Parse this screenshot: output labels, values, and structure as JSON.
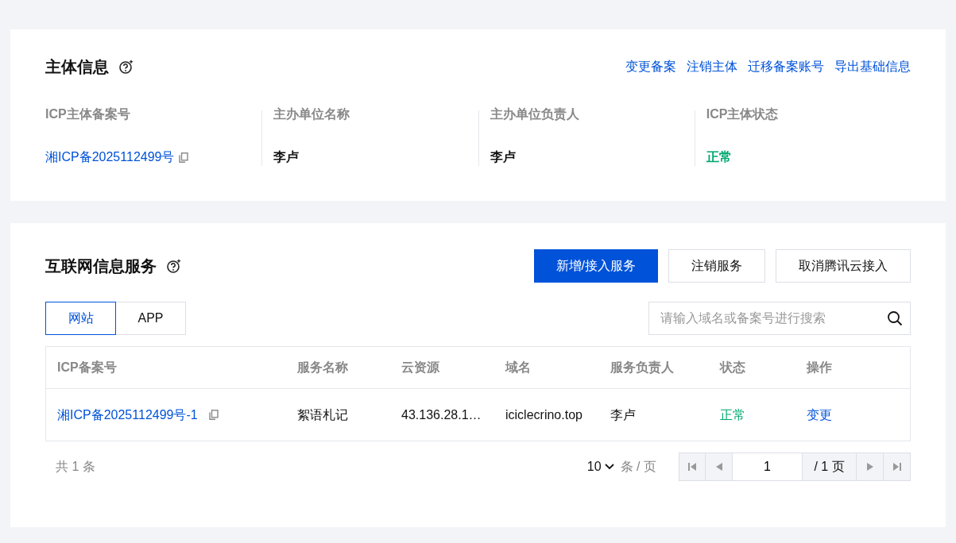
{
  "subject": {
    "title": "主体信息",
    "actions": [
      "变更备案",
      "注销主体",
      "迁移备案账号",
      "导出基础信息"
    ],
    "fields": [
      {
        "label": "ICP主体备案号",
        "value": "湘ICP备2025112499号",
        "kind": "link"
      },
      {
        "label": "主办单位名称",
        "value": "李卢",
        "kind": "text"
      },
      {
        "label": "主办单位负责人",
        "value": "李卢",
        "kind": "text"
      },
      {
        "label": "ICP主体状态",
        "value": "正常",
        "kind": "status"
      }
    ]
  },
  "services": {
    "title": "互联网信息服务",
    "buttons": [
      {
        "label": "新增/接入服务",
        "primary": true
      },
      {
        "label": "注销服务",
        "primary": false
      },
      {
        "label": "取消腾讯云接入",
        "primary": false
      }
    ],
    "tabs": [
      {
        "label": "网站",
        "selected": true
      },
      {
        "label": "APP",
        "selected": false
      }
    ],
    "search": {
      "placeholder": "请输入域名或备案号进行搜索"
    },
    "table": {
      "columns": [
        "ICP备案号",
        "服务名称",
        "云资源",
        "域名",
        "服务负责人",
        "状态",
        "操作"
      ],
      "rows": [
        [
          "湘ICP备2025112499号-1",
          "絮语札记",
          "43.136.28.1…",
          "iciclecrino.top",
          "李卢",
          "正常",
          "变更"
        ]
      ]
    },
    "pagination": {
      "total": "共 1 条",
      "page_size": "10",
      "page_size_unit": "条 / 页",
      "page": "1",
      "page_count": "/ 1 页"
    }
  }
}
